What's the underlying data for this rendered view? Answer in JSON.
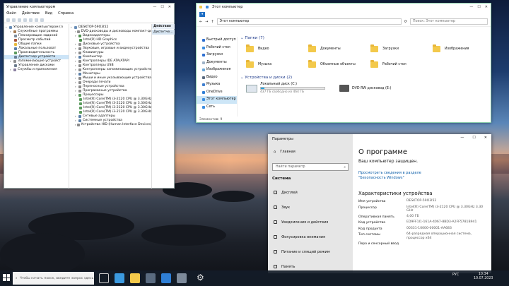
{
  "device_manager": {
    "title": "Управление компьютером",
    "menu": [
      "Файл",
      "Действие",
      "Вид",
      "Справка"
    ],
    "left_tree": [
      {
        "label": "Управление компьютером (л",
        "indent": 0,
        "color": "#6b8fb8"
      },
      {
        "label": "Служебные программы",
        "indent": 1,
        "color": "#a67c52"
      },
      {
        "label": "Планировщик заданий",
        "indent": 2,
        "color": "#7a8a9a"
      },
      {
        "label": "Просмотр событий",
        "indent": 2,
        "color": "#a7543a"
      },
      {
        "label": "Общие папки",
        "indent": 2,
        "color": "#e8b93d"
      },
      {
        "label": "Локальные пользоват",
        "indent": 2,
        "color": "#5a7fa8"
      },
      {
        "label": "Производительность",
        "indent": 2,
        "color": "#5b9b5e"
      },
      {
        "label": "Диспетчер устройств",
        "indent": 2,
        "color": "#6a7f95",
        "selected": true
      },
      {
        "label": "Запоминающие устройст",
        "indent": 1,
        "color": "#8f8f8f"
      },
      {
        "label": "Управление дисками",
        "indent": 2,
        "color": "#6d7c8d"
      },
      {
        "label": "Службы и приложения",
        "indent": 1,
        "color": "#8a7fa0"
      }
    ],
    "device_tree": [
      {
        "label": "DESKTOP-59O3I52",
        "indent": 0,
        "color": "#6b8fb8"
      },
      {
        "label": "DVD-дисководы и дисководы компакт-дисков",
        "indent": 1,
        "color": "#8f8f8f"
      },
      {
        "label": "Видеоадаптеры",
        "indent": 1,
        "color": "#4f8f4f"
      },
      {
        "label": "Intel(R) HD Graphics",
        "indent": 2,
        "color": "#4f8f4f"
      },
      {
        "label": "Дисковые устройства",
        "indent": 1,
        "color": "#8f8f8f"
      },
      {
        "label": "Звуковые, игровые и видеоустройства",
        "indent": 1,
        "color": "#8a8a8a"
      },
      {
        "label": "Клавиатуры",
        "indent": 1,
        "color": "#8a8a8a"
      },
      {
        "label": "Компьютер",
        "indent": 1,
        "color": "#5a7fa8"
      },
      {
        "label": "Контроллеры IDE ATA/ATAPI",
        "indent": 1,
        "color": "#8a8a8a"
      },
      {
        "label": "Контроллеры USB",
        "indent": 1,
        "color": "#8a8a8a"
      },
      {
        "label": "Контроллеры запоминающих устройств",
        "indent": 1,
        "color": "#8a8a8a"
      },
      {
        "label": "Мониторы",
        "indent": 1,
        "color": "#5a7fa8"
      },
      {
        "label": "Мыши и иные указывающие устройства",
        "indent": 1,
        "color": "#8a8a8a"
      },
      {
        "label": "Очереди печати",
        "indent": 1,
        "color": "#8a8a8a"
      },
      {
        "label": "Переносные устройства",
        "indent": 1,
        "color": "#8a8a8a"
      },
      {
        "label": "Программные устройства",
        "indent": 1,
        "color": "#8a8a8a"
      },
      {
        "label": "Процессоры",
        "indent": 1,
        "color": "#5b9b5e"
      },
      {
        "label": "Intel(R) Core(TM) i3-2120 CPU @ 3.30GHz",
        "indent": 2,
        "color": "#5b9b5e"
      },
      {
        "label": "Intel(R) Core(TM) i3-2120 CPU @ 3.30GHz",
        "indent": 2,
        "color": "#5b9b5e"
      },
      {
        "label": "Intel(R) Core(TM) i3-2120 CPU @ 3.30GHz",
        "indent": 2,
        "color": "#5b9b5e"
      },
      {
        "label": "Intel(R) Core(TM) i3-2120 CPU @ 3.30GHz",
        "indent": 2,
        "color": "#5b9b5e"
      },
      {
        "label": "Сетевые адаптеры",
        "indent": 1,
        "color": "#5a7fa8"
      },
      {
        "label": "Системные устройства",
        "indent": 1,
        "color": "#5a7fa8"
      },
      {
        "label": "Устройства HID (Human Interface Devices)",
        "indent": 1,
        "color": "#8a8a8a"
      }
    ],
    "actions_header": "Действия",
    "actions_item": "Диспетче..."
  },
  "explorer": {
    "title": "Этот компьютер",
    "address": "Этот компьютер",
    "search_placeholder": "Поиск: Этот компьютер",
    "nav": [
      {
        "label": "Быстрый доступ",
        "icon": "star-icon",
        "color": "#2e6fd1"
      },
      {
        "label": "Рабочий стол",
        "icon": "desktop-icon",
        "color": "#3c8de0"
      },
      {
        "label": "Загрузки",
        "icon": "download-icon",
        "color": "#2e6fd1"
      },
      {
        "label": "Документы",
        "icon": "document-icon",
        "color": "#9fb3c8"
      },
      {
        "label": "Изображения",
        "icon": "image-icon",
        "color": "#6aa7d8"
      },
      {
        "label": "Видео",
        "icon": "video-icon",
        "color": "#5a6b80"
      },
      {
        "label": "Музыка",
        "icon": "music-icon",
        "color": "#3f7fd0"
      },
      {
        "label": "OneDrive",
        "icon": "cloud-icon",
        "color": "#2f7fd6"
      },
      {
        "label": "Этот компьютер",
        "icon": "computer-icon",
        "color": "#3c8de0",
        "selected": true
      },
      {
        "label": "Сеть",
        "icon": "network-icon",
        "color": "#3c8de0"
      }
    ],
    "folders_header": "Папки (7)",
    "folders": [
      "Видео",
      "Документы",
      "Загрузки",
      "Изображения",
      "Музыка",
      "Объемные объекты",
      "Рабочий стол"
    ],
    "devices_header": "Устройства и диски (2)",
    "local_disk_label": "Локальный диск (C:)",
    "local_disk_free": "437 ГБ свободно из 464 ГБ",
    "local_disk_used_fraction": 0.06,
    "dvd_label": "DVD RW дисковод (E:)",
    "status": "Элементов: 9"
  },
  "settings": {
    "title": "Параметры",
    "home": "Главная",
    "search_placeholder": "Найти параметр",
    "section": "Система",
    "items": [
      {
        "label": "Дисплей",
        "icon": "display-icon"
      },
      {
        "label": "Звук",
        "icon": "sound-icon"
      },
      {
        "label": "Уведомления и действия",
        "icon": "notifications-icon"
      },
      {
        "label": "Фокусировка внимания",
        "icon": "focus-icon"
      },
      {
        "label": "Питание и спящий режим",
        "icon": "power-icon"
      },
      {
        "label": "Память",
        "icon": "storage-icon"
      }
    ],
    "page_title": "О программе",
    "protected": "Ваш компьютер защищен.",
    "security_link": "Просмотреть сведения в разделе \"Безопасность Windows\"",
    "spec_title": "Характеристики устройства",
    "specs": [
      {
        "k": "Имя устройства",
        "v": "DESKTOP-59O3I52"
      },
      {
        "k": "Процессор",
        "v": "Intel(R) Core(TM) i3-2120 CPU @ 3.30GHz 3.30 GHz"
      },
      {
        "k": "Оперативная память",
        "v": "4,00 ГБ"
      },
      {
        "k": "Код устройства",
        "v": "ED9FF1I1-161A-4067-8BD3-A2FF5781B941"
      },
      {
        "k": "Код продукта",
        "v": "00331-10000-00001-AA683"
      },
      {
        "k": "Тип системы",
        "v": "64-разрядная операционная система, процессор x64"
      },
      {
        "k": "Перо и сенсорный ввод",
        "v": ""
      }
    ]
  },
  "taskbar": {
    "search_placeholder": "Чтобы начать поиск, введите запрос здесь",
    "time": "10:34",
    "date": "10.07.2023",
    "lang": "РУС"
  },
  "watermark": "Avito"
}
